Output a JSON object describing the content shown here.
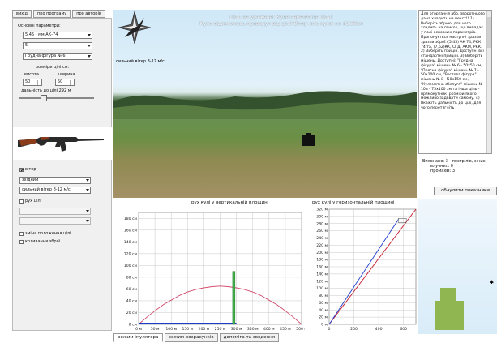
{
  "menu": [
    "вихід",
    "про програму",
    "про авторів"
  ],
  "left": {
    "params_label": "Основні параметри:",
    "weapon": "5,45 - мм АК-74",
    "second": "5",
    "target": "Грудна фігура № 6",
    "target_size_label": "розміри цілі см:",
    "height_label": "висота",
    "width_label": "ширина",
    "height_value": "50",
    "width_value": "50",
    "distance_label": "дальність до цілі 292 м",
    "wind_check": "вітер",
    "wind_type": "зхідний",
    "wind_strength": "сильний вітер 8-12 м/с",
    "motion_check": "рух цілі",
    "motion_sel1": "",
    "motion_sel2": "",
    "opt1": "зміна положення цілі",
    "opt2": "коливання зброї"
  },
  "scene": {
    "message_line1": "Ціль не уражена! Куля перелетіла ціль!",
    "message_line2": "Куля відхилилась праворуч від цілі! Вітер зніс кулю на 42,58см",
    "wind_text": "сильний вітер 8-12 м/с"
  },
  "info": {
    "text": "Для огортання або. зворотнього дана хладить на пекст!! 1) Виберіть зброю, для чого хладить на список, що випадає у полі основних параметрів. Пропонується наступні зразки зразки зброї: (5,45) АК 74, РКК 74 та, (7,62)КК, СГД, АКМ, РКК. 2) Виберіть прицін. Доступні всі стандартні прицілі. 3) Виберіть мішень. Доступні: \"Грудна фігура\" мішень № 6 - 50х50 см, \"Поясна фігура\" мішень № 7 - 50х100 см, \"Ростова фігура\" мішень № 8 - 50х150 см, \"Кулеметна обслуга\" мішень № 10а - 75х100 см та інша ціль - прямокутник, розміри якого можливо задавати самому. 4) Вкажіть дальність до цілі, для чого перетягніть"
  },
  "stats": {
    "shots_label": "Виконано: 3",
    "shots_label2": "пострілів, з них",
    "hits": "влучних: 0",
    "misses": "промахів: 3"
  },
  "reset_label": "обнулити показники",
  "chart_data": [
    {
      "type": "line",
      "title": "рух кулі у вертикальній площині",
      "x_ticks": [
        "0 м",
        "50 м",
        "100 м",
        "150 м",
        "200 м",
        "250 м",
        "300 м",
        "350 м",
        "400 м",
        "450 м",
        "500 м"
      ],
      "y_ticks": [
        "0 см",
        "20 см",
        "40 см",
        "60 см",
        "80 см",
        "100 см",
        "120 см",
        "140 см",
        "160 см",
        "180 см"
      ],
      "xlim": [
        0,
        500
      ],
      "ylim": [
        0,
        190
      ],
      "series": [
        {
          "color": "#d24a6a",
          "x": [
            0,
            25,
            50,
            75,
            100,
            125,
            150,
            175,
            200,
            225,
            250,
            275,
            300,
            325,
            350,
            375,
            400,
            425,
            450,
            475,
            500
          ],
          "y": [
            0,
            12,
            23,
            33,
            41,
            49,
            55,
            59,
            62,
            64,
            65,
            64,
            62,
            59,
            55,
            49,
            41,
            33,
            23,
            12,
            0
          ]
        },
        {
          "color": "#1c3dcc",
          "x": [
            0,
            300
          ],
          "y": [
            2,
            2
          ]
        }
      ],
      "target": {
        "x": 292,
        "y_bottom": 0,
        "y_top": 90
      }
    },
    {
      "type": "line",
      "title": "рух кулі у горизонтальній площині",
      "x_ticks": [
        "0",
        "200",
        "400",
        "600"
      ],
      "y_ticks": [
        "0 м",
        "20 м",
        "40 м",
        "60 м",
        "80 м",
        "100 м",
        "120 м",
        "140 м",
        "160 м",
        "180 м",
        "200 м",
        "220 м",
        "240 м",
        "260 м",
        "280 м",
        "300 м",
        "320 м"
      ],
      "xlim": [
        0,
        700
      ],
      "ylim": [
        0,
        320
      ],
      "series": [
        {
          "color": "#c41a2e",
          "x": [
            0,
            700
          ],
          "y": [
            0,
            320
          ]
        },
        {
          "color": "#1c3dcc",
          "x": [
            0,
            560
          ],
          "y": [
            0,
            292
          ]
        }
      ],
      "target": {
        "x": 590,
        "y": 292
      }
    }
  ],
  "tabs": [
    "режим імулятора",
    "режим розрахунків",
    "допоміга та зведення"
  ]
}
